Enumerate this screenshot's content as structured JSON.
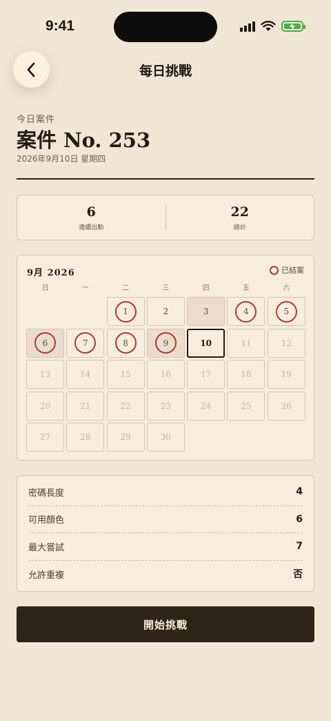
{
  "status_bar": {
    "time": "9:41"
  },
  "nav": {
    "title": "每日挑戰",
    "back_icon": "chevron-left-icon"
  },
  "case": {
    "label": "今日案件",
    "title": "案件 No. 253",
    "date": "2026年9月10日 星期四"
  },
  "stats": [
    {
      "value": "6",
      "label": "連續出勤"
    },
    {
      "value": "22",
      "label": "總計"
    }
  ],
  "calendar": {
    "month_label": "9月 2026",
    "legend_label": "已結案",
    "weekdays": [
      "日",
      "一",
      "二",
      "三",
      "四",
      "五",
      "六"
    ],
    "leading_blanks": 2,
    "days": [
      {
        "n": "1",
        "state": "done"
      },
      {
        "n": "2",
        "state": "past"
      },
      {
        "n": "3",
        "state": "shaded"
      },
      {
        "n": "4",
        "state": "done"
      },
      {
        "n": "5",
        "state": "done"
      },
      {
        "n": "6",
        "state": "done-shaded"
      },
      {
        "n": "7",
        "state": "done"
      },
      {
        "n": "8",
        "state": "done"
      },
      {
        "n": "9",
        "state": "done-shaded"
      },
      {
        "n": "10",
        "state": "today"
      },
      {
        "n": "11",
        "state": "future"
      },
      {
        "n": "12",
        "state": "future"
      },
      {
        "n": "13",
        "state": "future"
      },
      {
        "n": "14",
        "state": "future"
      },
      {
        "n": "15",
        "state": "future"
      },
      {
        "n": "16",
        "state": "future"
      },
      {
        "n": "17",
        "state": "future"
      },
      {
        "n": "18",
        "state": "future"
      },
      {
        "n": "19",
        "state": "future"
      },
      {
        "n": "20",
        "state": "future"
      },
      {
        "n": "21",
        "state": "future"
      },
      {
        "n": "22",
        "state": "future"
      },
      {
        "n": "23",
        "state": "future"
      },
      {
        "n": "24",
        "state": "future"
      },
      {
        "n": "25",
        "state": "future"
      },
      {
        "n": "26",
        "state": "future"
      },
      {
        "n": "27",
        "state": "future"
      },
      {
        "n": "28",
        "state": "future"
      },
      {
        "n": "29",
        "state": "future"
      },
      {
        "n": "30",
        "state": "future"
      }
    ]
  },
  "settings": [
    {
      "label": "密碼長度",
      "value": "4"
    },
    {
      "label": "可用顏色",
      "value": "6"
    },
    {
      "label": "最大嘗試",
      "value": "7"
    },
    {
      "label": "允許重複",
      "value": "否"
    }
  ],
  "start_button": {
    "label": "開始挑戰"
  },
  "colors": {
    "background": "#f0e6d4",
    "card": "#f6eddc",
    "accent_ring": "#b23a32",
    "button_bg": "#2d2419",
    "button_text": "#f3e7d2"
  }
}
